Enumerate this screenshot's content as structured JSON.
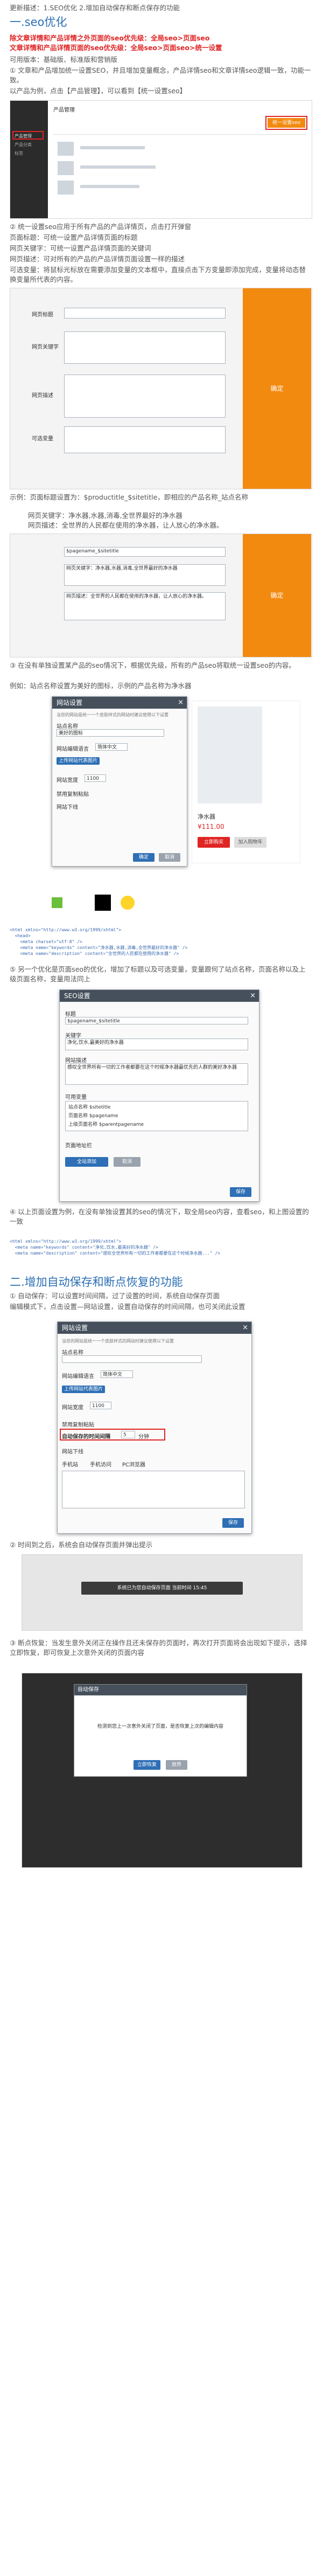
{
  "intro": {
    "update_note": "更新描述：1.SEO优化 2.增加自动保存和断点保存的功能"
  },
  "seo_section": {
    "heading": "一.seo优化",
    "red_line1": "除文章详情和产品详情之外页面的seo优先级：全局seo>页面seo",
    "red_line2": "文章详情和产品详情页面的seo优先级：全局seo>页面seo>统一设置",
    "role_line": "可用版本：基础版、标准版和营销版",
    "point1": "①  文章和产品增加统一设置SEO，并且增加变量概念，产品详情seo和文章详情seo逻辑一致，功能一致。",
    "point1_sub": "以产品为例，点击【产品管理】，可以看到【统一设置seo】",
    "point2": "②  统一设置seo应用于所有产品的产品详情页，点击打开弹窗",
    "page_title_label": "页面标题：可统一设置产品详情页面的标题",
    "keyword_label": "网页关键字：可统一设置产品详情页面的关键词",
    "desc_label": "网页描述：可对所有的产品的产品详情页面设置一样的描述",
    "note_line": "可选变量：将鼠标光标放在需要添加变量的文本框中，直接点击下方变量即添加完成，变量将动态替换变量所代表的内容。",
    "example_line": "示例：页面标题设置为：$productitle_$sitetitle，即相应的产品名称_站点名称",
    "example_kw": "网页关键字：净水器,水器,消毒,全世界最好的净水器",
    "example_desc": "网页描述：全世界的人民都在使用的净水器，让人放心的净水器。",
    "point3": "③  在没有单独设置某产品的seo情况下，根据优先级，所有的产品seo将取统一设置seo的内容。",
    "point3_sub": "例如：站点名称设置为美好的图标，示例的产品名称为净水器",
    "point4": "⑤  另一个优化是页面seo的优化，增加了标题以及可选变量，变量跟何了站点名称，页面名称以及上级页面名称，变量用法同上",
    "point5": "④  以上页面设置为例，在没有单独设置其的seo的情况下，取全局seo内容，查看seo，和上图设置的一致"
  },
  "autosave_section": {
    "heading": "二.增加自动保存和断点恢复的功能",
    "p1": "①  自动保存：可以设置时间间隔，过了设置的时间，系统自动保存页面",
    "p1b": "编辑模式下，点击设置—网站设置，设置自动保存的时间间隔，也可关闭此设置",
    "p2": "②  时间到之后，系统会自动保存页面并弹出提示",
    "p3": "③  断点恢复：当发生意外关闭正在操作且还未保存的页面时，再次打开页面将会出现如下提示，选择立即恢复，即可恢复上次意外关闭的页面内容"
  },
  "admin_shot": {
    "tab_label": "产品管理",
    "button_label": "统一设置seo",
    "sidebar_items": [
      "产品管理",
      "产品分类",
      "标签"
    ]
  },
  "seo_form": {
    "labels": [
      "网页标题",
      "网页关键字",
      "网页描述",
      "可选变量"
    ],
    "submit_label": "确定"
  },
  "site_dialog": {
    "title": "网站设置",
    "close": "×",
    "tip": "当您的网站是统一一个皮肤样式的网站时建议使用以下设置",
    "name_label": "站点名称",
    "name_value": "美好的图标",
    "lang_label": "网站编辑语言",
    "lang_value": "简体中文",
    "upload_label": "上传网站代表图片",
    "width_label": "网站宽度",
    "width_value": "1100",
    "copy_label": "禁用复制粘贴",
    "footer_label": "网站下线",
    "confirm": "确定",
    "cancel": "取消"
  },
  "product_shot": {
    "name": "净水器",
    "price": "¥111.00",
    "buy_label": "立即购买",
    "cart_label": "加入购物车"
  },
  "seo_dialog": {
    "title": "SEO设置",
    "close": "×",
    "title_label": "标题",
    "title_value": "$pagename_$sitetitle",
    "kw_label": "关键字",
    "kw_value": "净化,饮水,最美好的净水器",
    "desc_label": "网站描述",
    "desc_value": "感叹全世界所有一切的工作者都要在这个时候净水器最优先的人群的美好净水器",
    "var_label": "可用变量",
    "vars": [
      "站点名称 $sitetitle",
      "页面名称 $pagename",
      "上级页面名称 $parentpagename"
    ],
    "follow_label": "页面地址栏",
    "save_label": "保存",
    "apply_label": "全站添加",
    "cancel_label": "取消"
  },
  "autosave_dialog": {
    "title": "网站设置",
    "auto_label": "自动保存的时间间隔",
    "auto_value": "5",
    "unit": "分钟",
    "mobile_label": "手机站",
    "mobile_option": "手机访问",
    "pc_option": "PC浏览器",
    "confirm": "保存"
  },
  "toast": {
    "text": "系统已为您自动保存页面 当前时间 15:45"
  },
  "restore_dialog": {
    "title": "自动保存",
    "msg": "检测到您上一次意外关闭了页面，是否恢复上次的编辑内容",
    "ok": "立即恢复",
    "cancel": "放弃"
  }
}
